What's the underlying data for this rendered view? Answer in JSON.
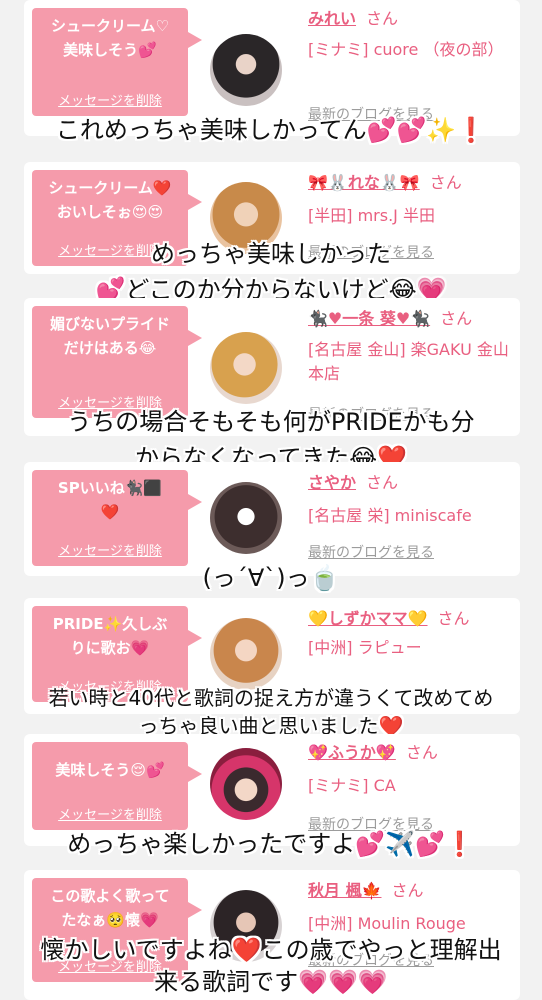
{
  "common": {
    "delete_label": "メッセージを削除",
    "blog_label": "最新のブログを見る",
    "san": "さん"
  },
  "messages": [
    {
      "bubble": "シュークリーム♡\n美味しそう💕",
      "name": "みれい",
      "shop": "[ミナミ] cuore （夜の部）",
      "overlay": "これめっちゃ美味しかってん💕💕✨❗️"
    },
    {
      "bubble": "シュークリーム❤️\nおいしそぉ😍😍",
      "name": "🎀🐰れな🐰🎀",
      "shop": "[半田] mrs.J 半田",
      "overlay": "めっちゃ美味しかった\n💕どこのか分からないけど😂💗"
    },
    {
      "bubble": "媚びないプライド\nだけはある😂",
      "name": "🐈‍⬛♥一条 葵♥🐈‍⬛",
      "shop": "[名古屋 金山] 楽GAKU 金山本店",
      "overlay": "うちの場合そもそも何がPRIDEかも分\nからなくなってきた😂❤️"
    },
    {
      "bubble": "SPいいね🐈‍⬛⬛\n❤️",
      "name": "さやか",
      "shop": "[名古屋 栄] miniscafe",
      "overlay": "(っ´∀`)っ🍵"
    },
    {
      "bubble": "PRIDE✨久しぶ\nりに歌お💗",
      "name": "💛しずかママ💛",
      "shop": "[中洲] ラピュー",
      "overlay": "若い時と40代と歌詞の捉え方が違うくて改めてめ\nっちゃ良い曲と思いました❤️"
    },
    {
      "bubble": "美味しそう😌💕",
      "name": "💖ふうか💖",
      "shop": "[ミナミ] CA",
      "overlay": "めっちゃ楽しかったですよ💕✈️💕❗️"
    },
    {
      "bubble": "この歌よく歌って\nたなぁ🥺懐💗",
      "name": "秋月 楓🍁",
      "shop": "[中洲] Moulin Rouge",
      "overlay": "懐かしいですよね❤️この歳でやっと理解出\n来る歌詞です💗💗💗"
    }
  ],
  "colors": {
    "accent": "#e95f80",
    "bubble": "#f59bab",
    "background": "#f2f2f2",
    "card": "#ffffff",
    "muted": "#9c9c9c"
  }
}
